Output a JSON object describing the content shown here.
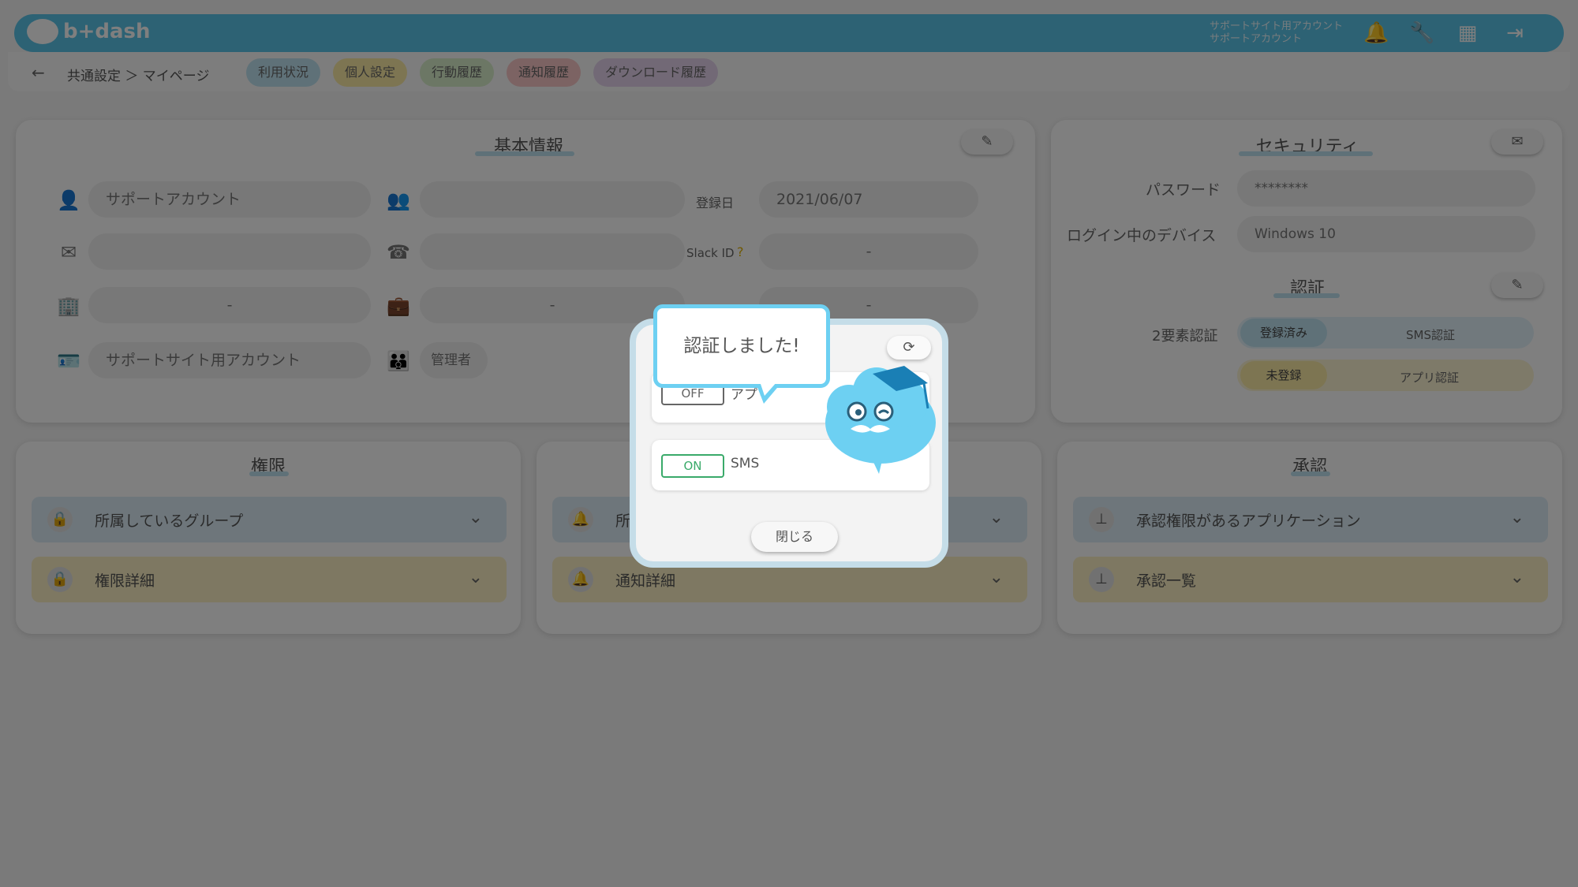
{
  "header": {
    "logo": "b+dash",
    "account_line1": "サポートサイト用アカウント",
    "account_line2": "サポートアカウント",
    "icons": [
      "bell-icon",
      "wrench-icon",
      "grid-icon",
      "logout-icon"
    ]
  },
  "breadcrumb": "共通設定 ＞ マイページ",
  "tabs": [
    {
      "label": "利用状況",
      "color": "#bfe3f1"
    },
    {
      "label": "個人設定",
      "color": "#fbeaa5"
    },
    {
      "label": "行動履歴",
      "color": "#d8eeca"
    },
    {
      "label": "通知履歴",
      "color": "#f8c6c6"
    },
    {
      "label": "ダウンロード履歴",
      "color": "#e4d3ec"
    }
  ],
  "basic": {
    "title": "基本情報",
    "name": "サポートアカウント",
    "register_label": "登録日",
    "register_date": "2021/06/07",
    "slack_label": "Slack ID",
    "dash": "-",
    "site_account": "サポートサイト用アカウント",
    "role": "管理者"
  },
  "security": {
    "title": "セキュリティ",
    "password_label": "パスワード",
    "password_value": "********",
    "device_label": "ログイン中のデバイス",
    "device_value": "Windows 10",
    "auth_title": "認証",
    "twofa_label": "2要素認証",
    "registered": "登録済み",
    "sms_auth": "SMS認証",
    "unregistered": "未登録",
    "app_auth": "アプリ認証"
  },
  "permissions": {
    "title": "権限",
    "group": "所属しているグループ",
    "detail": "権限詳細"
  },
  "notifications": {
    "item1": "所",
    "detail": "通知詳細"
  },
  "approval": {
    "title": "承認",
    "apps": "承認権限があるアプリケーション",
    "list": "承認一覧"
  },
  "modal": {
    "bubble": "認証しました!",
    "app_toggle": "OFF",
    "app_label": "アプリ",
    "sms_toggle": "ON",
    "sms_label": "SMS",
    "close": "閉じる"
  }
}
